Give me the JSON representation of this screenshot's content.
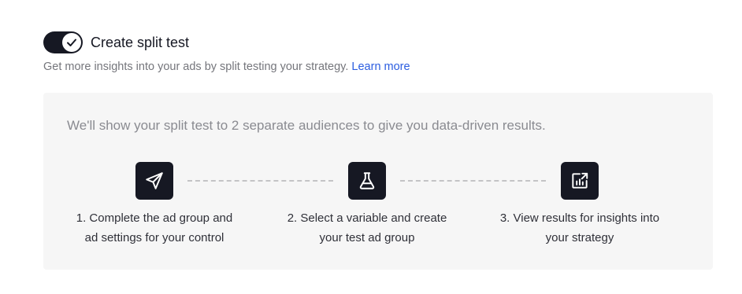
{
  "toggle": {
    "state": "on",
    "label": "Create split test"
  },
  "subtitle": {
    "text": "Get more insights into your ads by split testing your strategy.",
    "link_label": "Learn more"
  },
  "panel": {
    "intro": "We'll show your split test to 2 separate audiences to give you data-driven results.",
    "steps": [
      {
        "icon": "send-icon",
        "line1": "1. Complete the ad group and",
        "line2": "ad settings for your control"
      },
      {
        "icon": "flask-icon",
        "line1": "2. Select a variable and create",
        "line2": "your test ad group"
      },
      {
        "icon": "chart-report-icon",
        "line1": "3. View results for insights into",
        "line2": "your strategy"
      }
    ]
  },
  "colors": {
    "toggle_on": "#161823",
    "link": "#2b5de0",
    "panel_bg": "#f6f6f6",
    "icon_tile": "#161823"
  }
}
